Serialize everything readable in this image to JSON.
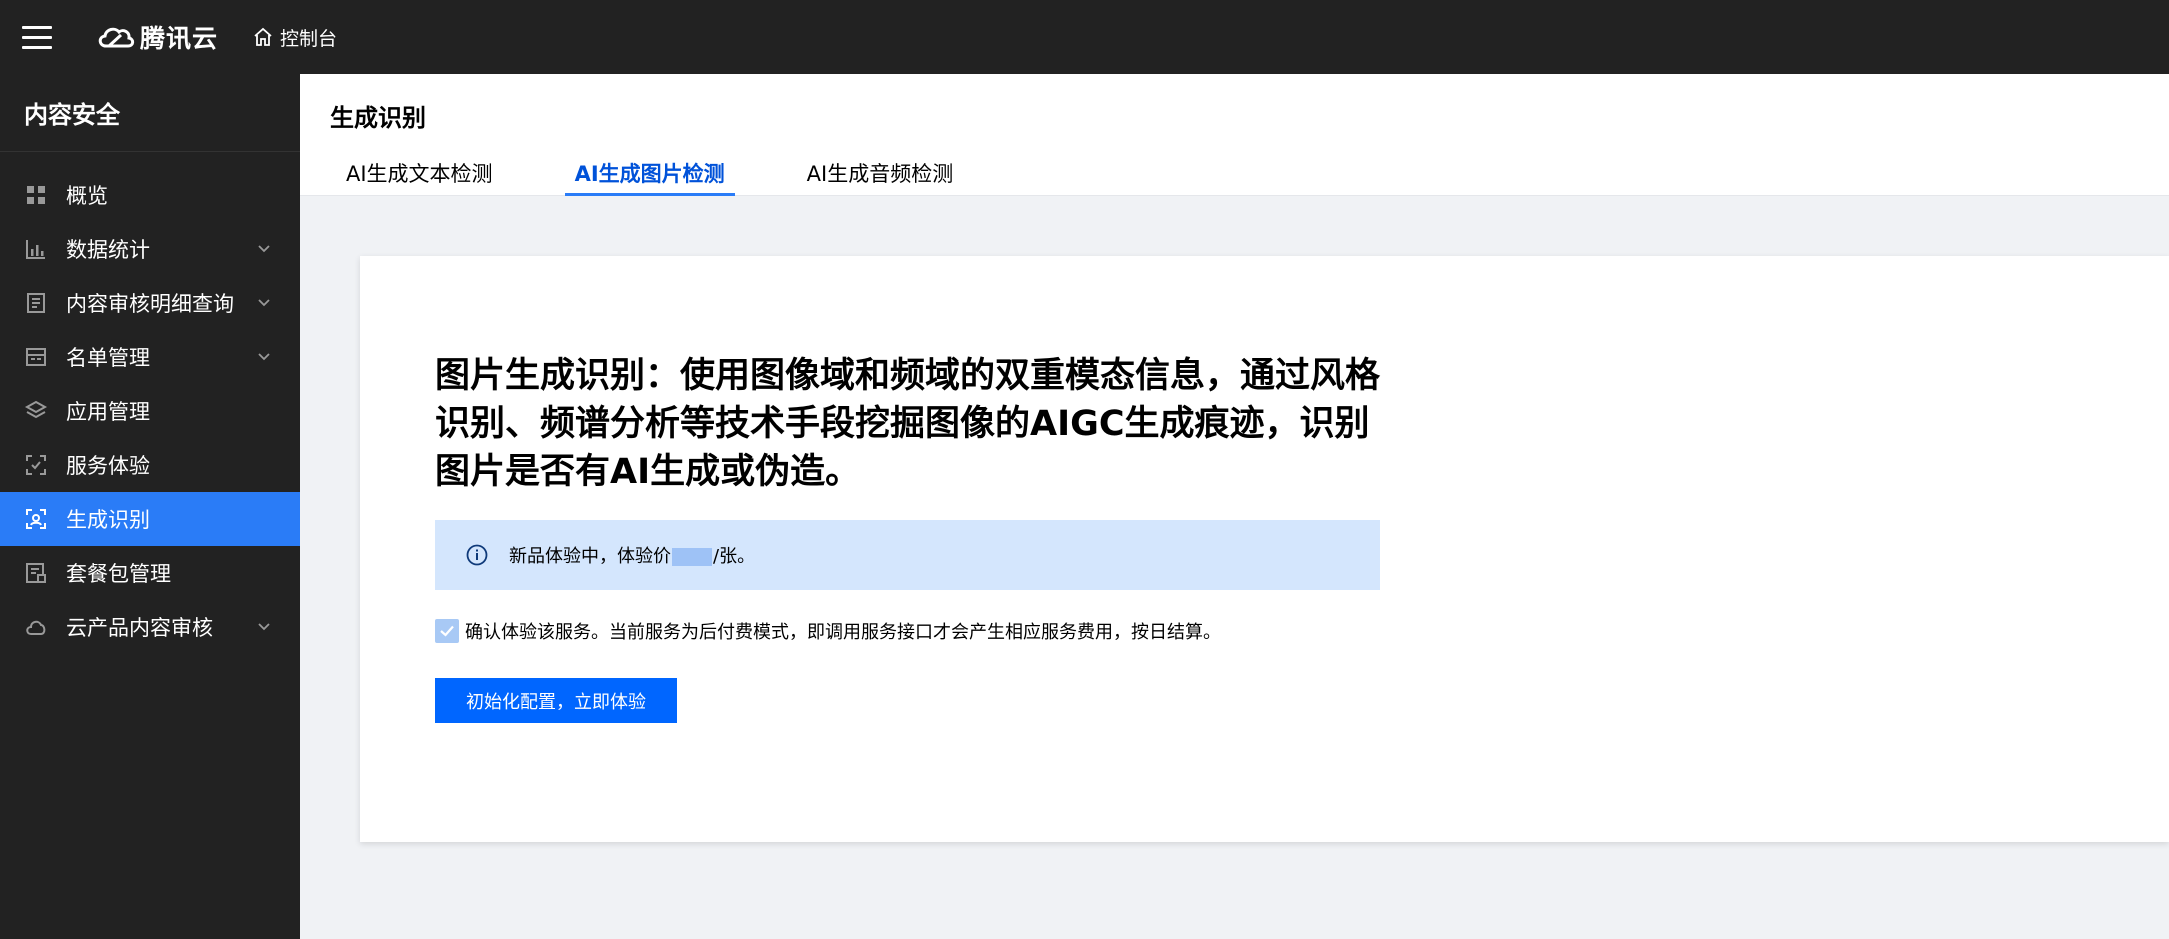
{
  "topbar": {
    "logo_text": "腾讯云",
    "console_label": "控制台"
  },
  "sidebar": {
    "title": "内容安全",
    "items": [
      {
        "label": "概览",
        "icon": "grid-icon",
        "has_children": false,
        "active": false
      },
      {
        "label": "数据统计",
        "icon": "bar-chart-icon",
        "has_children": true,
        "active": false
      },
      {
        "label": "内容审核明细查询",
        "icon": "document-list-icon",
        "has_children": true,
        "active": false
      },
      {
        "label": "名单管理",
        "icon": "list-box-icon",
        "has_children": true,
        "active": false
      },
      {
        "label": "应用管理",
        "icon": "layers-icon",
        "has_children": false,
        "active": false
      },
      {
        "label": "服务体验",
        "icon": "scan-check-icon",
        "has_children": false,
        "active": false
      },
      {
        "label": "生成识别",
        "icon": "scan-face-icon",
        "has_children": false,
        "active": true
      },
      {
        "label": "套餐包管理",
        "icon": "package-icon",
        "has_children": false,
        "active": false
      },
      {
        "label": "云产品内容审核",
        "icon": "cloud-icon",
        "has_children": true,
        "active": false
      }
    ]
  },
  "page": {
    "title": "生成识别",
    "tabs": [
      {
        "label": "AI生成文本检测",
        "active": false
      },
      {
        "label": "AI生成图片检测",
        "active": true
      },
      {
        "label": "AI生成音频检测",
        "active": false
      }
    ]
  },
  "card": {
    "headline": "图片生成识别：使用图像域和频域的双重模态信息，通过风格识别、频谱分析等技术手段挖掘图像的AIGC生成痕迹，识别图片是否有AI生成或伪造。",
    "notice_prefix": "新品体验中，体验价",
    "notice_suffix": "/张。",
    "confirm_text": "确认体验该服务。当前服务为后付费模式，即调用服务接口才会产生相应服务费用，按日结算。",
    "confirm_checked": true,
    "cta_label": "初始化配置，立即体验"
  },
  "colors": {
    "topbar_bg": "#222222",
    "accent": "#2a7cf7",
    "cta_bg": "#0066ff",
    "notice_bg": "#d4e6fd"
  }
}
